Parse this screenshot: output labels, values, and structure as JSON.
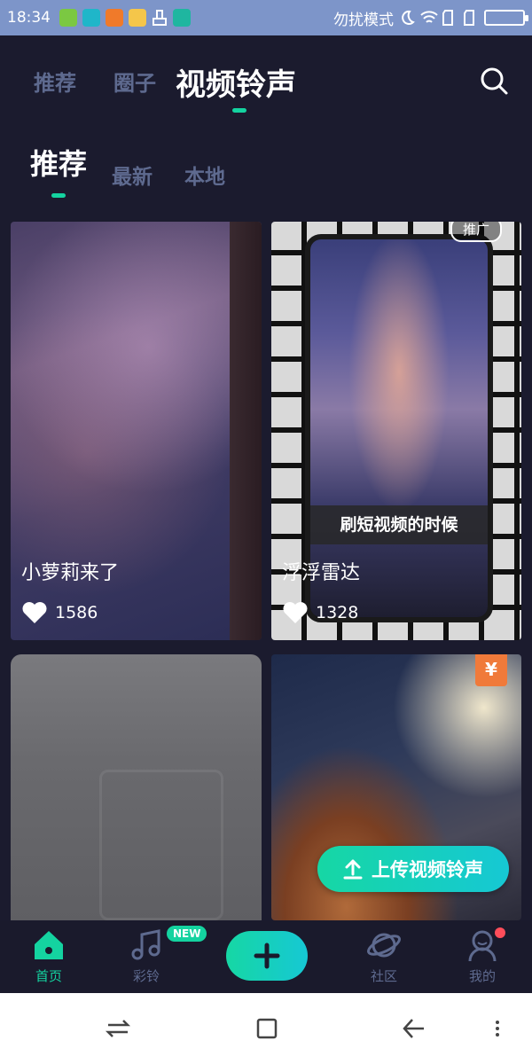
{
  "status_bar": {
    "time": "18:34",
    "dnd_label": "勿扰模式"
  },
  "top_tabs": [
    {
      "label": "推荐",
      "active": false
    },
    {
      "label": "圈子",
      "active": false
    },
    {
      "label": "视频铃声",
      "active": true
    }
  ],
  "sub_tabs": [
    {
      "label": "推荐",
      "active": true
    },
    {
      "label": "最新",
      "active": false
    },
    {
      "label": "本地",
      "active": false
    }
  ],
  "cards": [
    {
      "title": "小萝莉来了",
      "likes": "1586"
    },
    {
      "title": "浮浮雷达",
      "likes": "1328",
      "badge": "推广",
      "caption": "刷短视频的时候"
    },
    {
      "title": "",
      "likes": ""
    },
    {
      "title": "",
      "likes": "",
      "badge": "¥"
    }
  ],
  "upload_button": {
    "label": "上传视频铃声"
  },
  "tabbar": {
    "items": [
      {
        "label": "首页",
        "icon": "home-icon",
        "active": true
      },
      {
        "label": "彩铃",
        "icon": "music-note-icon",
        "badge": "NEW"
      },
      {
        "label": "",
        "icon": "plus-icon"
      },
      {
        "label": "社区",
        "icon": "planet-icon"
      },
      {
        "label": "我的",
        "icon": "profile-icon"
      }
    ]
  },
  "colors": {
    "accent": "#14d3a0",
    "background": "#1b1b2e",
    "inactive": "#5e6a8f",
    "status_bar": "#7d95c9"
  }
}
